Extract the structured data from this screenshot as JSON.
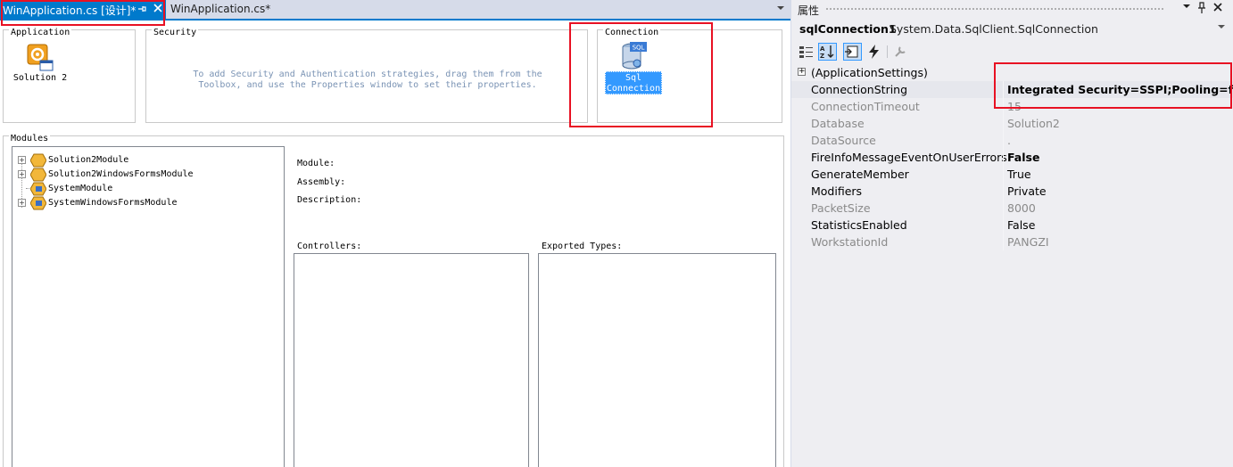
{
  "document_tabs": {
    "active_tab": "WinApplication.cs [设计]*",
    "inactive_tab": "WinApplication.cs*",
    "pin_glyph": "⊥",
    "close_glyph": "✕"
  },
  "designer": {
    "application_title": "Application",
    "solution_label": "Solution 2",
    "security_title": "Security",
    "security_hint": "To add Security and Authentication strategies, drag them from the\nToolbox, and use the Properties window to set their properties.",
    "connection_title": "Connection",
    "sql_connection_label": "Sql\nConnection",
    "sql_icon_text": "SQL",
    "modules_title": "Modules",
    "modules": [
      {
        "label": "Solution2Module",
        "expandable": true
      },
      {
        "label": "Solution2WindowsFormsModule",
        "expandable": true
      },
      {
        "label": "SystemModule",
        "expandable": false
      },
      {
        "label": "SystemWindowsFormsModule",
        "expandable": true
      }
    ],
    "module_label": "Module:",
    "assembly_label": "Assembly:",
    "description_label": "Description:",
    "controllers_label": "Controllers:",
    "exported_types_label": "Exported Types:"
  },
  "properties": {
    "title": "属性",
    "object_name": "sqlConnection1",
    "object_type": "System.Data.SqlClient.SqlConnection",
    "category": "(ApplicationSettings)",
    "rows": [
      {
        "name": "ConnectionString",
        "value": "Integrated Security=SSPI;Pooling=false;",
        "readonly": false,
        "bold": true,
        "highlight": true
      },
      {
        "name": "ConnectionTimeout",
        "value": "15",
        "readonly": true,
        "bold": false
      },
      {
        "name": "Database",
        "value": "Solution2",
        "readonly": true,
        "bold": false
      },
      {
        "name": "DataSource",
        "value": ".",
        "readonly": true,
        "bold": false
      },
      {
        "name": "FireInfoMessageEventOnUserErrors",
        "value": "False",
        "readonly": false,
        "bold": true
      },
      {
        "name": "GenerateMember",
        "value": "True",
        "readonly": false,
        "bold": false
      },
      {
        "name": "Modifiers",
        "value": "Private",
        "readonly": false,
        "bold": false
      },
      {
        "name": "PacketSize",
        "value": "8000",
        "readonly": true,
        "bold": false
      },
      {
        "name": "StatisticsEnabled",
        "value": "False",
        "readonly": false,
        "bold": false
      },
      {
        "name": "WorkstationId",
        "value": "PANGZI",
        "readonly": true,
        "bold": false
      }
    ]
  },
  "colors": {
    "accent": "#007acc",
    "selection": "#3399ff",
    "highlight_box": "#e81123",
    "hint_text": "#7a93b4"
  },
  "icons": [
    "pin-icon",
    "close-icon",
    "chevron-down-icon",
    "solution-icon",
    "sql-database-icon",
    "module-icon",
    "categorized-icon",
    "alphabetical-icon",
    "properties-icon",
    "events-icon",
    "property-pages-icon"
  ]
}
